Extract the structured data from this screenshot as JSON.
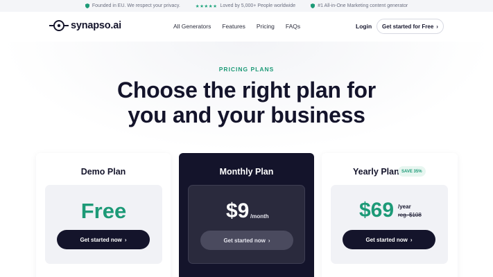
{
  "topbar": {
    "founded": "Founded in EU. We respect your privacy.",
    "stars": "★★★★★",
    "loved": "Loved by 5,000+ People worldwide",
    "rank": "#1 All-in-One Marketing content generator"
  },
  "header": {
    "logo": "synapso.ai",
    "nav": [
      "All Generators",
      "Features",
      "Pricing",
      "FAQs"
    ],
    "login": "Login",
    "cta": "Get started for Free",
    "cta_chevron": "›"
  },
  "hero": {
    "eyebrow": "PRICING PLANS",
    "headline_line1": "Choose the right plan for",
    "headline_line2": "you and your business"
  },
  "plans": {
    "demo": {
      "title": "Demo Plan",
      "price": "Free",
      "button": "Get started now",
      "chevron": "›"
    },
    "monthly": {
      "title": "Monthly Plan",
      "price": "$9",
      "period": "/month",
      "button": "Get started now",
      "chevron": "›"
    },
    "yearly": {
      "title": "Yearly Plan",
      "badge": "SAVE 35%",
      "price": "$69",
      "period": "/year",
      "old_price": "reg. $108",
      "button": "Get started now",
      "chevron": "›"
    }
  },
  "colors": {
    "accent": "#1d9a77",
    "dark": "#14142b"
  }
}
